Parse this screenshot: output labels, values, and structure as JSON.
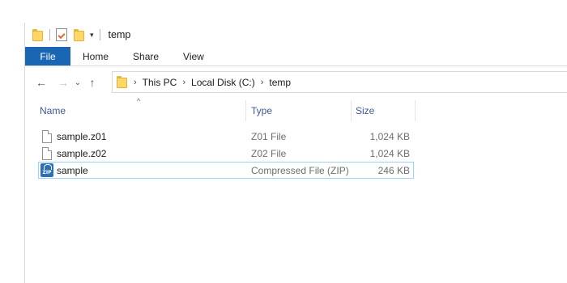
{
  "window": {
    "title": "temp",
    "quick_access_caret": "▾"
  },
  "ribbon": {
    "tabs": [
      {
        "label": "File"
      },
      {
        "label": "Home"
      },
      {
        "label": "Share"
      },
      {
        "label": "View"
      }
    ]
  },
  "nav": {
    "back": "←",
    "forward": "→",
    "recent": "⌄",
    "up": "↑"
  },
  "address": {
    "separator": "›",
    "crumbs": [
      "This PC",
      "Local Disk (C:)",
      "temp"
    ]
  },
  "columns": {
    "name": "Name",
    "type": "Type",
    "size": "Size",
    "sort_indicator": "^"
  },
  "files": [
    {
      "name": "sample.z01",
      "type": "Z01 File",
      "size": "1,024 KB",
      "icon": "file-icon"
    },
    {
      "name": "sample.z02",
      "type": "Z02 File",
      "size": "1,024 KB",
      "icon": "file-icon"
    },
    {
      "name": "sample",
      "type": "Compressed File (ZIP)",
      "size": "246 KB",
      "icon": "zip-icon",
      "icon_text": "ZIP"
    }
  ],
  "colors": {
    "file_tab": "#1a66b5",
    "column_header": "#3b5998",
    "selection_border": "#99d1ff"
  }
}
